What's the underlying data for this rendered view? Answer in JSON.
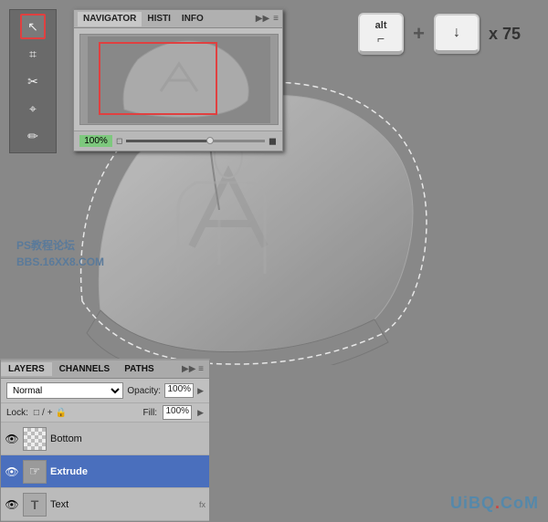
{
  "canvas": {
    "background": "#888888"
  },
  "navigator": {
    "title": "NAVIGATOR",
    "tabs": [
      "NAVIGATOR",
      "HISTI",
      "INFO"
    ],
    "zoom_label": "100%"
  },
  "keyboard": {
    "alt_label": "alt",
    "alt_symbol": "⌐",
    "plus_sign": "+",
    "arrow_down": "↓",
    "multiplier": "x 75"
  },
  "toolbar": {
    "tools": [
      "↖",
      "✂",
      "⌖",
      "⬡",
      "◈"
    ]
  },
  "layers": {
    "tabs": [
      "LAYERS",
      "CHANNELS",
      "PATHS"
    ],
    "blend_mode": "Normal",
    "opacity_label": "Opacity:",
    "opacity_value": "100%",
    "lock_label": "Lock:",
    "lock_icons": [
      "□",
      "/",
      "+",
      "🔒"
    ],
    "fill_label": "Fill:",
    "fill_value": "100%",
    "items": [
      {
        "name": "Bottom",
        "type": "checker",
        "visible": true,
        "selected": false
      },
      {
        "name": "Extrude",
        "type": "hand",
        "visible": true,
        "selected": true
      },
      {
        "name": "Text",
        "type": "T",
        "visible": true,
        "selected": false
      }
    ]
  },
  "watermark": {
    "line1": "PS教程论坛",
    "line2": "BBS.16XX8.COM"
  },
  "uibq": {
    "text": "UiBQ.CoM"
  }
}
